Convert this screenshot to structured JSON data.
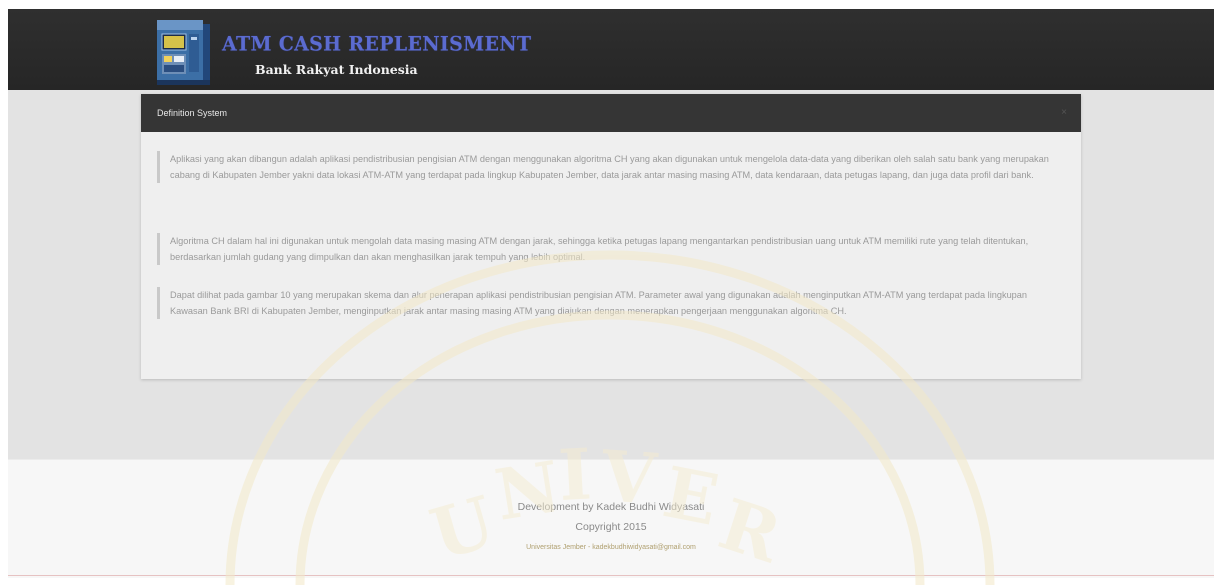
{
  "header": {
    "title": "ATM CASH REPLENISMENT",
    "subtitle": "Bank Rakyat Indonesia"
  },
  "panel": {
    "title": "Definition System",
    "close_symbol": "×",
    "paragraphs": [
      "Aplikasi yang akan dibangun adalah aplikasi pendistribusian pengisian ATM dengan menggunakan algoritma CH yang akan digunakan untuk mengelola data-data yang diberikan oleh salah satu bank yang merupakan cabang di Kabupaten Jember yakni data lokasi ATM-ATM yang terdapat pada lingkup Kabupaten Jember, data jarak antar masing masing ATM, data kendaraan, data petugas lapang, dan juga data profil dari bank.",
      "Algoritma CH dalam hal ini digunakan untuk mengolah data masing masing ATM dengan jarak, sehingga ketika petugas lapang mengantarkan pendistribusian uang untuk ATM memiliki rute yang telah ditentukan, berdasarkan jumlah gudang yang dimpulkan dan akan menghasilkan jarak tempuh yang lebih optimal.",
      "Dapat dilihat pada gambar 10 yang merupakan skema dan alur penerapan aplikasi pendistribusian pengisian ATM. Parameter awal yang digunakan adalah menginputkan ATM-ATM yang terdapat pada lingkupan Kawasan Bank BRI di Kabupaten Jember, menginputkan jarak antar masing masing ATM yang diajukan dengan menerapkan pengerjaan menggunakan algoritma CH."
    ]
  },
  "footer": {
    "line1": "Development by Kadek Budhi Widyasati",
    "line2": "Copyright 2015",
    "line3": "Universitas Jember - kadekbudhiwidyasati@gmail.com"
  },
  "icons": {
    "logo": "atm-machine-icon"
  },
  "colors": {
    "header_bg": "#2b2b2b",
    "brand_title": "#5b6bd0",
    "panel_head": "#353535",
    "content_bg": "#e3e3e3"
  }
}
